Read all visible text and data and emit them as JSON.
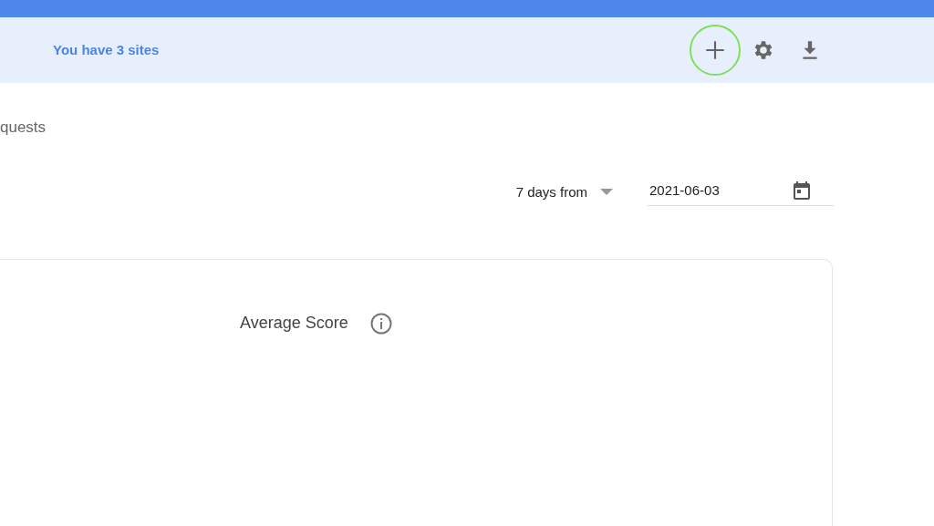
{
  "header": {
    "sites_text": "You have 3 sites",
    "actions": [
      {
        "kind": "add",
        "highlighted": true
      },
      {
        "kind": "settings",
        "highlighted": false
      },
      {
        "kind": "download",
        "highlighted": false
      }
    ]
  },
  "page_title": "quests",
  "range": {
    "label": "7 days from",
    "date": "2021-06-03"
  },
  "card": {
    "title": "Average Score"
  }
}
